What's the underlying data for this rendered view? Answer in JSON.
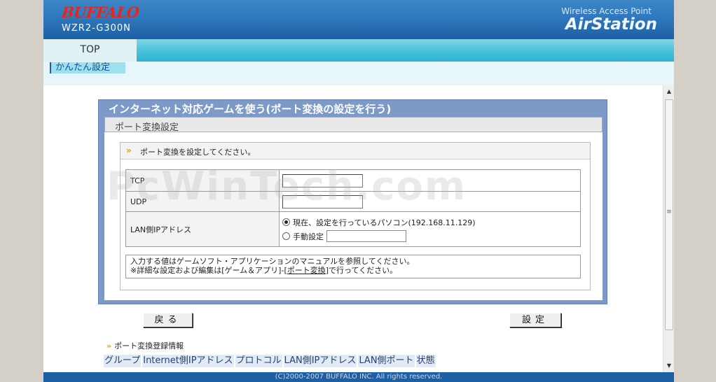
{
  "header": {
    "brand": "BUFFALO",
    "model": "WZR2-G300N",
    "product_line": "Wireless Access Point",
    "product_name": "AirStation"
  },
  "tabs": [
    {
      "label": "TOP"
    }
  ],
  "subnav": {
    "label": "かんたん設定"
  },
  "panel": {
    "title": "インターネット対応ゲームを使う(ポート変換の設定を行う)",
    "section_title": "ポート変換設定",
    "intro": "ポート変換を設定してください。",
    "fields": {
      "tcp_label": "TCP",
      "tcp_value": "",
      "udp_label": "UDP",
      "udp_value": "",
      "lan_ip_label": "LAN側IPアドレス",
      "radio_current": "現在、設定を行っているパソコン(192.168.11.129)",
      "radio_manual": "手動設定",
      "manual_value": ""
    },
    "notes": {
      "line1": "入力する値はゲームソフト・アプリケーションのマニュアルを参照してください。",
      "line2_prefix": "※詳細な設定および編集は[ゲーム＆アプリ]-[",
      "line2_link": "ポート変換",
      "line2_suffix": "]で行ってください。"
    }
  },
  "buttons": {
    "back": "戻る",
    "submit": "設定"
  },
  "registration": {
    "title": "ポート変換登録情報",
    "columns": [
      "グループ",
      "Internet側IPアドレス",
      "プロトコル",
      "LAN側IPアドレス",
      "LAN側ポート",
      "状態"
    ]
  },
  "watermark": "PcWinTech.com",
  "footer": "(C)2000-2007 BUFFALO INC. All rights reserved."
}
